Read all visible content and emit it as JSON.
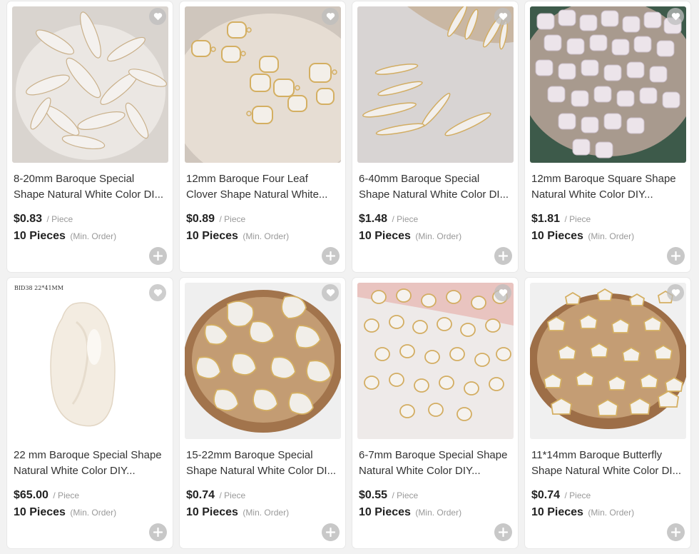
{
  "colors": {
    "accent_gray": "#c8c8c8",
    "price": "#222222",
    "muted": "#999999"
  },
  "products": [
    {
      "title": "8-20mm Baroque Special Shape Natural White Color DI...",
      "price": "$0.83",
      "unit": "/ Piece",
      "moq": "10 Pieces",
      "moq_label": "(Min. Order)",
      "image": "biwa-stick-pearls-pile"
    },
    {
      "title": "12mm Baroque Four Leaf Clover Shape Natural White...",
      "price": "$0.89",
      "unit": "/ Piece",
      "moq": "10 Pieces",
      "moq_label": "(Min. Order)",
      "image": "clover-pearl-connectors-on-shell"
    },
    {
      "title": "6-40mm Baroque Special Shape Natural White Color DI...",
      "price": "$1.48",
      "unit": "/ Piece",
      "moq": "10 Pieces",
      "moq_label": "(Min. Order)",
      "image": "chili-shape-pearl-pendants"
    },
    {
      "title": "12mm Baroque Square Shape Natural White Color DIY...",
      "price": "$1.81",
      "unit": "/ Piece",
      "moq": "10 Pieces",
      "moq_label": "(Min. Order)",
      "image": "square-pearls-pile"
    },
    {
      "title": "22 mm Baroque Special Shape Natural White Color DIY...",
      "price": "$65.00",
      "unit": "/ Piece",
      "moq": "10 Pieces",
      "moq_label": "(Min. Order)",
      "image": "single-large-baroque-pearl",
      "watermark": "BID38 22*41MM"
    },
    {
      "title": "15-22mm Baroque Special Shape Natural White Color DI...",
      "price": "$0.74",
      "unit": "/ Piece",
      "moq": "10 Pieces",
      "moq_label": "(Min. Order)",
      "image": "pearl-connectors-on-wood-slice"
    },
    {
      "title": "6-7mm Baroque Special Shape Natural White Color DIY...",
      "price": "$0.55",
      "unit": "/ Piece",
      "moq": "10 Pieces",
      "moq_label": "(Min. Order)",
      "image": "small-gold-edged-pearls"
    },
    {
      "title": "11*14mm Baroque Butterfly Shape Natural White Color DI...",
      "price": "$0.74",
      "unit": "/ Piece",
      "moq": "10 Pieces",
      "moq_label": "(Min. Order)",
      "image": "butterfly-pearl-pendants-on-wood"
    }
  ]
}
